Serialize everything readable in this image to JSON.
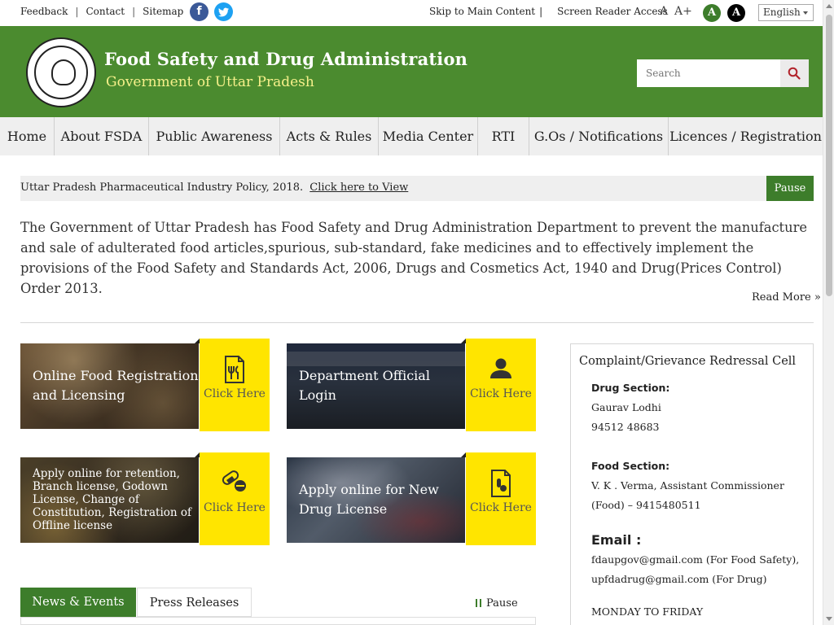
{
  "topbar": {
    "links": [
      "Feedback",
      "Contact",
      "Sitemap"
    ],
    "facebook": "facebook-icon",
    "twitter": "twitter-icon",
    "skip": "Skip to Main Content",
    "reader": "Screen Reader Access",
    "font_small": "A",
    "font_large": "A+",
    "theme_green": "A",
    "theme_black": "A",
    "language": "English"
  },
  "header": {
    "title": "Food Safety and Drug Administration",
    "subtitle": "Government of Uttar Pradesh",
    "search_placeholder": "Search"
  },
  "nav": [
    {
      "label": "Home",
      "w": 67
    },
    {
      "label": "About FSDA",
      "w": 116
    },
    {
      "label": "Public Awareness",
      "w": 161
    },
    {
      "label": "Acts & Rules",
      "w": 121
    },
    {
      "label": "Media Center",
      "w": 122
    },
    {
      "label": "RTI",
      "w": 63
    },
    {
      "label": "G.Os / Notifications",
      "w": 171
    },
    {
      "label": "Licences / Registration",
      "w": 189
    }
  ],
  "ticker": {
    "text": "Uttar Pradesh Pharmaceutical Industry Policy, 2018.",
    "link": "Click here to View",
    "pause": "Pause"
  },
  "intro": {
    "text": "The Government of Uttar Pradesh has Food Safety and Drug Administration Department to prevent the manufacture and sale of adulterated food articles,spurious, sub-standard, fake medicines and to effectively implement the provisions of the Food Safety and Standards Act, 2006, Drugs and Cosmetics Act, 1940 and Drug(Prices Control) Order 2013.",
    "read_more": "Read More »"
  },
  "cards": [
    {
      "label": "Online Food Registration and Licensing",
      "cta": "Click Here",
      "icon": "food-license-icon"
    },
    {
      "label": "Department Official Login",
      "cta": "Click Here",
      "icon": "user-icon"
    },
    {
      "label": "Apply online for retention, Branch license, Godown License, Change of Constitution, Registration of Offline license",
      "cta": "Click Here",
      "icon": "pills-icon"
    },
    {
      "label": "Apply online for New Drug License",
      "cta": "Click Here",
      "icon": "drug-license-icon"
    }
  ],
  "tabs": {
    "news": "News & Events",
    "press": "Press Releases",
    "pause": "Pause"
  },
  "panel": {
    "title": "Complaint/Grievance Redressal Cell",
    "drug_heading": "Drug Section:",
    "drug_name": "Gaurav Lodhi",
    "drug_phone": "94512 48683",
    "food_heading": "Food Section:",
    "food_line1": "V. K . Verma, Assistant Commissioner",
    "food_line2": "(Food) – 9415480511",
    "email_heading": "Email :",
    "email1": "fdaupgov@gmail.com (For Food Safety),",
    "email2": "upfdadrug@gmail.com (For Drug)",
    "days": "MONDAY TO FRIDAY"
  },
  "colors": {
    "brand_green": "#4b8b2f",
    "accent_green": "#3d7d2b",
    "cta_yellow": "#ffe500",
    "subtitle_yellow": "#f6f08a"
  }
}
